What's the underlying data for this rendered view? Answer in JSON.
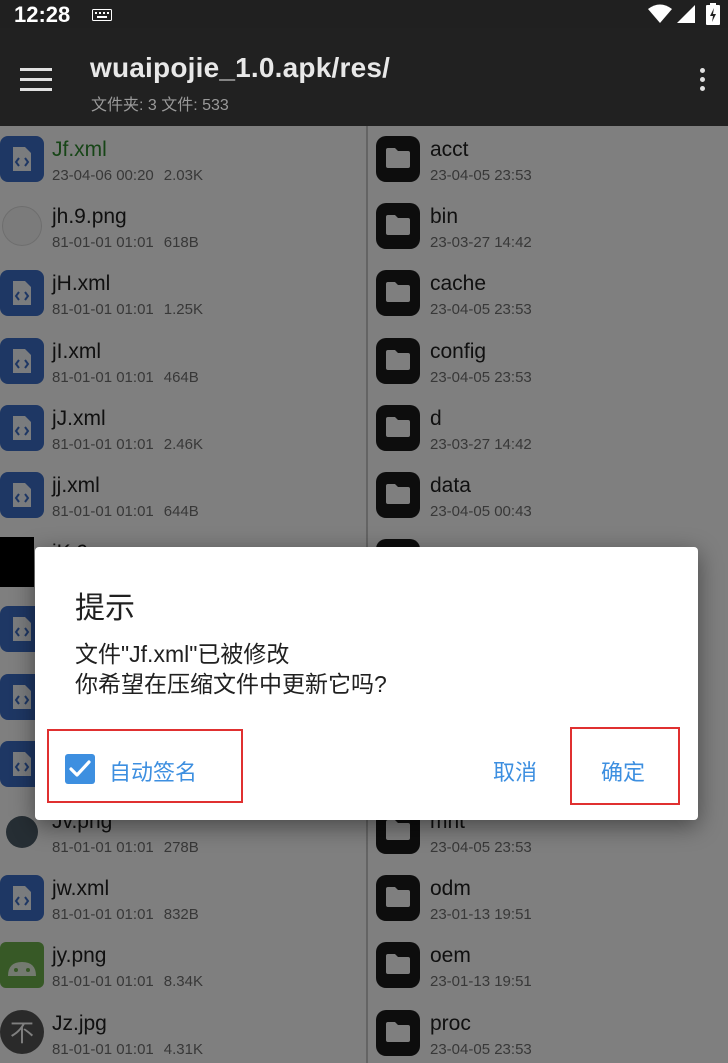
{
  "status": {
    "time": "12:28"
  },
  "toolbar": {
    "title": "wuaipojie_1.0.apk/res/",
    "subtitle": "文件夹: 3  文件: 533"
  },
  "left_files": [
    {
      "name": "Jf.xml",
      "date": "23-04-06 00:20",
      "size": "2.03K",
      "icon": "xml-file-icon",
      "selected": true
    },
    {
      "name": "jh.9.png",
      "date": "81-01-01 01:01",
      "size": "618B",
      "icon": "png-image-icon"
    },
    {
      "name": "jH.xml",
      "date": "81-01-01 01:01",
      "size": "1.25K",
      "icon": "xml-file-icon"
    },
    {
      "name": "jI.xml",
      "date": "81-01-01 01:01",
      "size": "464B",
      "icon": "xml-file-icon"
    },
    {
      "name": "jJ.xml",
      "date": "81-01-01 01:01",
      "size": "2.46K",
      "icon": "xml-file-icon"
    },
    {
      "name": "jj.xml",
      "date": "81-01-01 01:01",
      "size": "644B",
      "icon": "xml-file-icon"
    },
    {
      "name": "jK.9...",
      "date": "",
      "size": "",
      "icon": "black-image-icon"
    },
    {
      "name": "",
      "date": "",
      "size": "",
      "icon": "xml-file-icon"
    },
    {
      "name": "",
      "date": "",
      "size": "",
      "icon": "xml-file-icon"
    },
    {
      "name": "",
      "date": "",
      "size": "",
      "icon": "xml-file-icon"
    },
    {
      "name": "Jv.png",
      "date": "81-01-01 01:01",
      "size": "278B",
      "icon": "png-image-icon"
    },
    {
      "name": "jw.xml",
      "date": "81-01-01 01:01",
      "size": "832B",
      "icon": "xml-file-icon"
    },
    {
      "name": "jy.png",
      "date": "81-01-01 01:01",
      "size": "8.34K",
      "icon": "android-image-icon"
    },
    {
      "name": "Jz.jpg",
      "date": "81-01-01 01:01",
      "size": "4.31K",
      "icon": "jpg-image-icon"
    }
  ],
  "right_folders": [
    {
      "name": "acct",
      "date": "23-04-05 23:53"
    },
    {
      "name": "bin",
      "date": "23-03-27 14:42"
    },
    {
      "name": "cache",
      "date": "23-04-05 23:53"
    },
    {
      "name": "config",
      "date": "23-04-05 23:53"
    },
    {
      "name": "d",
      "date": "23-03-27 14:42"
    },
    {
      "name": "data",
      "date": "23-04-05 00:43"
    },
    {
      "name": "",
      "date": ""
    },
    {
      "name": "",
      "date": ""
    },
    {
      "name": "",
      "date": ""
    },
    {
      "name": "",
      "date": ""
    },
    {
      "name": "mnt",
      "date": "23-04-05 23:53"
    },
    {
      "name": "odm",
      "date": "23-01-13 19:51"
    },
    {
      "name": "oem",
      "date": "23-01-13 19:51"
    },
    {
      "name": "proc",
      "date": "23-04-05 23:53"
    }
  ],
  "dialog": {
    "title": "提示",
    "message_line1": "文件\"Jf.xml\"已被修改",
    "message_line2": "你希望在压缩文件中更新它吗?",
    "checkbox_label": "自动签名",
    "checkbox_checked": true,
    "cancel_label": "取消",
    "ok_label": "确定"
  },
  "colors": {
    "accent": "#3d8fe0",
    "selected_file": "#2e8b2e",
    "highlight_box": "#e03030"
  }
}
